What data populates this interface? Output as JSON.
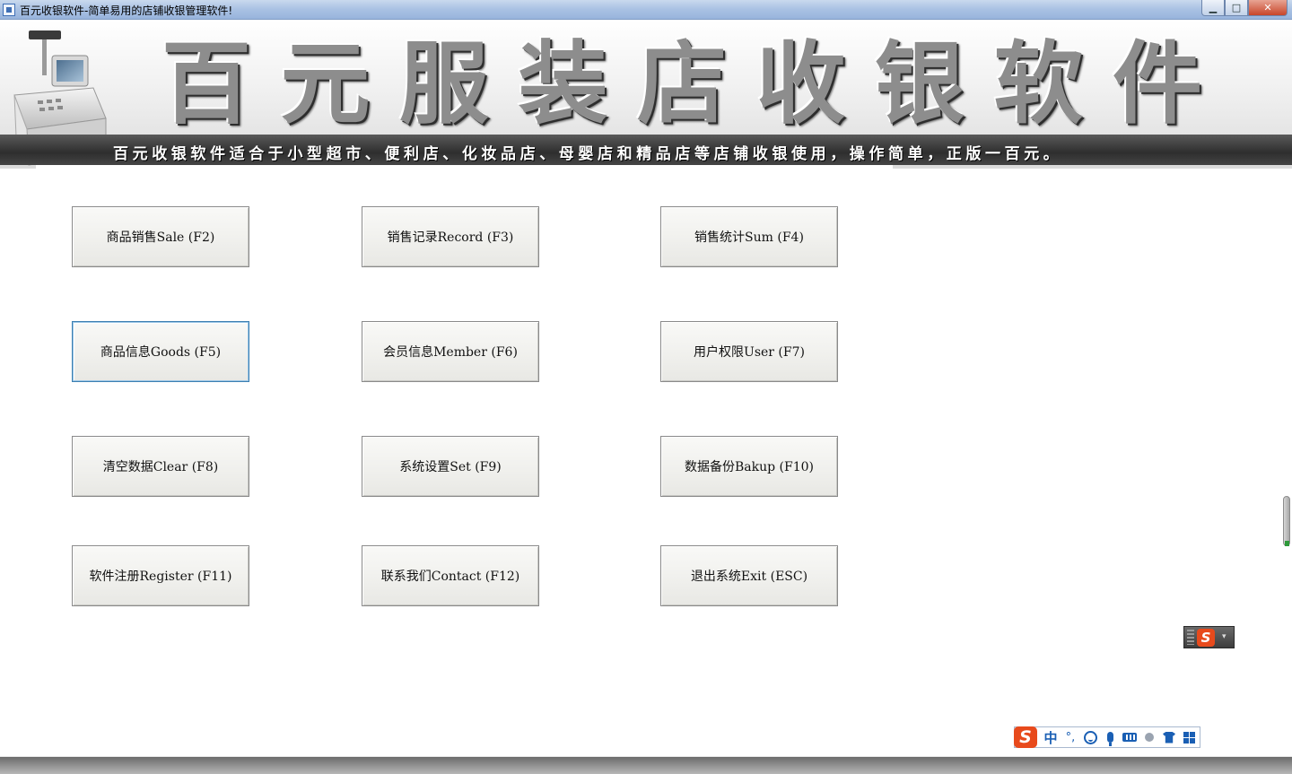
{
  "window": {
    "title": "百元收银软件-简单易用的店铺收银管理软件!",
    "minimize_glyph": "▁",
    "maximize_glyph": "□",
    "close_glyph": "✕"
  },
  "banner": {
    "title_chars": [
      "百",
      "元",
      "服",
      "装",
      "店",
      "收",
      "银",
      "软",
      "件"
    ],
    "slogan": "百元收银软件适合于小型超市、便利店、化妆品店、母婴店和精品店等店铺收银使用，操作简单，正版一百元。"
  },
  "menu": {
    "sale": "商品销售Sale (F2)",
    "record": "销售记录Record (F3)",
    "sum": "销售统计Sum (F4)",
    "goods": "商品信息Goods (F5)",
    "member": "会员信息Member (F6)",
    "user": "用户权限User (F7)",
    "clear": "清空数据Clear (F8)",
    "set": "系统设置Set (F9)",
    "bakup": "数据备份Bakup (F10)",
    "register": "软件注册Register (F11)",
    "contact": "联系我们Contact (F12)",
    "exit": "退出系统Exit (ESC)"
  },
  "ime": {
    "logo": "S",
    "lang": "中",
    "punct": "°,",
    "arrow": "▾"
  },
  "colors": {
    "title_bar": "#a9c1e3",
    "button_face": "#f1f1ee",
    "focus_border": "#3c7fb1",
    "ime_logo": "#e84a1c",
    "ime_icon": "#1a5fb4"
  }
}
